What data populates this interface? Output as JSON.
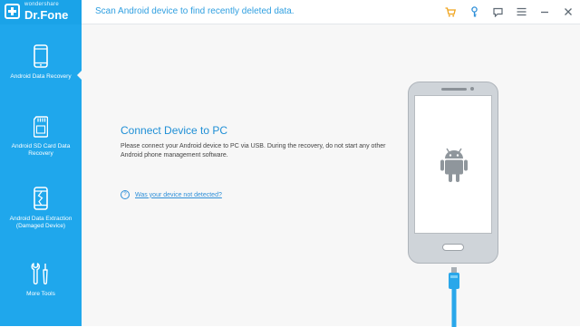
{
  "brand": {
    "top": "wondershare",
    "name": "Dr.Fone"
  },
  "window": {
    "title": "Scan Android device to find recently deleted data."
  },
  "toolbar": {
    "icons": [
      "cart-icon",
      "key-icon",
      "feedback-icon",
      "menu-icon",
      "minimize-icon",
      "close-icon"
    ]
  },
  "sidebar": {
    "items": [
      {
        "label": "Android Data Recovery",
        "icon": "phone-icon",
        "active": true
      },
      {
        "label": "Android SD Card Data\nRecovery",
        "icon": "sd-card-icon",
        "active": false
      },
      {
        "label": "Android Data Extraction\n(Damaged Device)",
        "icon": "broken-phone-icon",
        "active": false
      },
      {
        "label": "More Tools",
        "icon": "tools-icon",
        "active": false
      }
    ]
  },
  "main": {
    "heading": "Connect Device to PC",
    "description": "Please connect your Android device to PC via USB. During the recovery, do not start any other Android phone management software.",
    "help_link": "Was your device not detected?",
    "help_icon": "?"
  },
  "colors": {
    "accent": "#1fa7ec",
    "link": "#2e8fd8",
    "title": "#1f8fd6",
    "background": "#f7f7f7"
  }
}
